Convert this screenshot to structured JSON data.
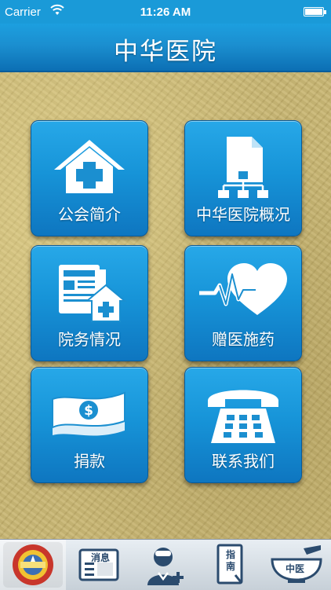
{
  "status_bar": {
    "carrier": "Carrier",
    "time": "11:26 AM"
  },
  "nav": {
    "title": "中华医院"
  },
  "tiles": [
    {
      "label": "公会简介",
      "icon": "house-medical-icon"
    },
    {
      "label": "中华医院概况",
      "icon": "document-sitemap-icon"
    },
    {
      "label": "院务情况",
      "icon": "news-house-icon"
    },
    {
      "label": "赠医施药",
      "icon": "heartbeat-icon"
    },
    {
      "label": "捐款",
      "icon": "money-icon"
    },
    {
      "label": "联系我们",
      "icon": "telephone-icon"
    }
  ],
  "tabbar": {
    "tabs": [
      {
        "name": "emblem",
        "text": "",
        "active": true
      },
      {
        "name": "news",
        "text": "消息"
      },
      {
        "name": "doctor",
        "text": ""
      },
      {
        "name": "guide",
        "text": "指南"
      },
      {
        "name": "tcm",
        "text": "中医"
      }
    ]
  },
  "colors": {
    "tile": "#1794d8",
    "nav": "#1b8fd0",
    "background": "#c8b570"
  }
}
